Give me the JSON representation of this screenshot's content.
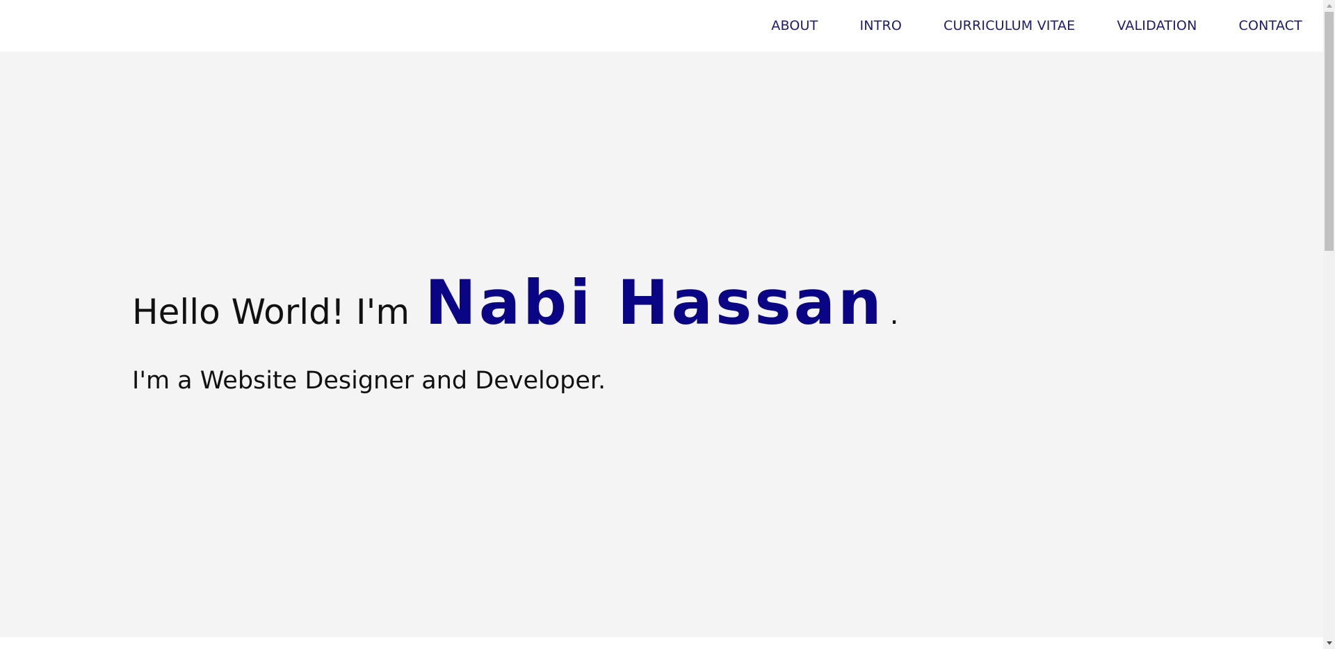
{
  "nav": {
    "items": [
      {
        "label": "ABOUT"
      },
      {
        "label": "INTRO"
      },
      {
        "label": "CURRICULUM VITAE"
      },
      {
        "label": "VALIDATION"
      },
      {
        "label": "CONTACT"
      }
    ]
  },
  "hero": {
    "greeting": "Hello World! I'm",
    "name": "Nabi Hassan",
    "period": ".",
    "subtitle": "I'm a Website Designer and Developer."
  },
  "colors": {
    "nav_text": "#1c1a6b",
    "name_accent": "#0a0585",
    "hero_background": "#f4f4f4"
  },
  "icons": {
    "scroll_up": "scroll-up-arrow-icon",
    "scroll_down": "scroll-down-arrow-icon"
  }
}
